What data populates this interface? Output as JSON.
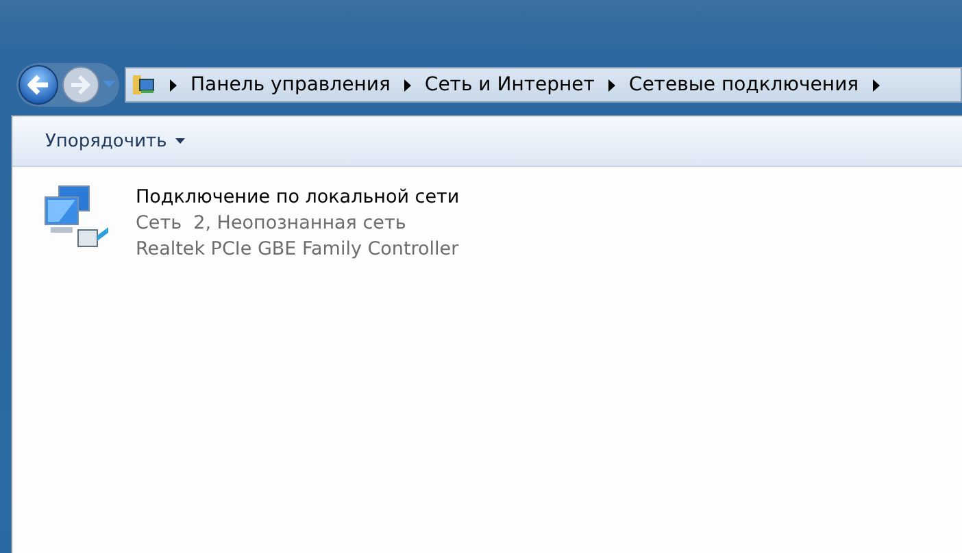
{
  "address_bar": {
    "breadcrumbs": [
      "Панель управления",
      "Сеть и Интернет",
      "Сетевые подключения"
    ]
  },
  "toolbar": {
    "organize": "Упорядочить"
  },
  "connections": [
    {
      "name": "Подключение по локальной сети",
      "status": "Сеть  2, Неопознанная сеть",
      "device": "Realtek PCIe GBE Family Controller"
    }
  ]
}
